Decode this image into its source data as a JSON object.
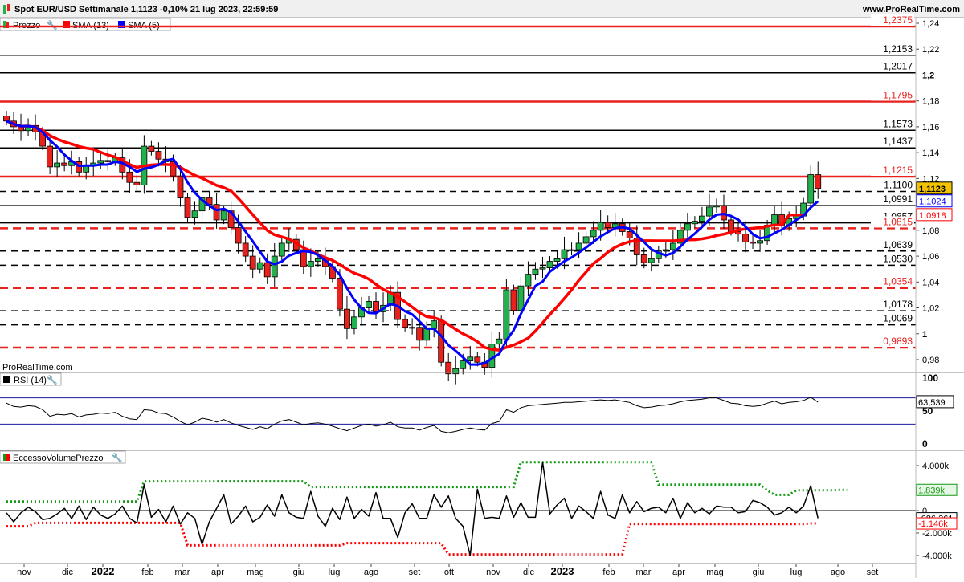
{
  "header": {
    "title": "Spot EUR/USD Settimanale 1,1123 -0,10% 21 lug 2023, 22:59:59",
    "site": "www.ProRealTime.com"
  },
  "watermark": "ProRealTime.com",
  "legend": {
    "price": "Prezzo",
    "sma13": "SMA (13)",
    "sma5": "SMA (5)"
  },
  "colors": {
    "up": "#22b14c",
    "down": "#e8211d",
    "sma13": "#ff0000",
    "sma5": "#0000ff",
    "support_red": "#e8211d",
    "volume_upper": "#139a13",
    "volume_lower": "#ff0000",
    "rsi_band": "#1a1aa0",
    "current_price_box": "#f2c300"
  },
  "chart_data": [
    {
      "type": "candlestick",
      "title": "Spot EUR/USD Settimanale",
      "ylim": [
        0.97,
        1.245
      ],
      "yticks": [
        {
          "v": 1.24,
          "label": "1,24"
        },
        {
          "v": 1.22,
          "label": "1,22"
        },
        {
          "v": 1.2,
          "label": "1,2"
        },
        {
          "v": 1.18,
          "label": "1,18"
        },
        {
          "v": 1.16,
          "label": "1,16"
        },
        {
          "v": 1.14,
          "label": "1,14"
        },
        {
          "v": 1.12,
          "label": "1,12"
        },
        {
          "v": 1.08,
          "label": "1,08"
        },
        {
          "v": 1.06,
          "label": "1,06"
        },
        {
          "v": 1.04,
          "label": "1,04"
        },
        {
          "v": 1.02,
          "label": "1,02"
        },
        {
          "v": 1.0,
          "label": "1"
        },
        {
          "v": 0.98,
          "label": "0,98"
        }
      ],
      "x_labels": [
        "nov",
        "dic",
        "2022",
        "feb",
        "mar",
        "apr",
        "mag",
        "giu",
        "lug",
        "ago",
        "set",
        "ott",
        "nov",
        "dic",
        "2023",
        "feb",
        "mar",
        "apr",
        "mag",
        "giu",
        "lug",
        "ago",
        "set"
      ],
      "bold_x_labels": [
        "2022",
        "2023"
      ],
      "levels": [
        {
          "value": 1.2375,
          "label": "1,2375",
          "color": "red",
          "style": "solid"
        },
        {
          "value": 1.2153,
          "label": "1,2153",
          "color": "black",
          "style": "solid"
        },
        {
          "value": 1.2017,
          "label": "1,2017",
          "color": "black",
          "style": "solid"
        },
        {
          "value": 1.1795,
          "label": "1,1795",
          "color": "red",
          "style": "solid"
        },
        {
          "value": 1.1573,
          "label": "1,1573",
          "color": "black",
          "style": "solid"
        },
        {
          "value": 1.1437,
          "label": "1,1437",
          "color": "black",
          "style": "solid"
        },
        {
          "value": 1.1215,
          "label": "1,1215",
          "color": "red",
          "style": "solid"
        },
        {
          "value": 1.11,
          "label": "1,1100",
          "color": "black",
          "style": "dashed"
        },
        {
          "value": 1.0991,
          "label": "1,0991",
          "color": "black",
          "style": "solid"
        },
        {
          "value": 1.0857,
          "label": "1,0857",
          "color": "black",
          "style": "solid"
        },
        {
          "value": 1.0815,
          "label": "1,0815",
          "color": "red",
          "style": "dashed"
        },
        {
          "value": 1.0639,
          "label": "1,0639",
          "color": "black",
          "style": "dashed"
        },
        {
          "value": 1.053,
          "label": "1,0530",
          "color": "black",
          "style": "dashed"
        },
        {
          "value": 1.0354,
          "label": "1,0354",
          "color": "red",
          "style": "dashed"
        },
        {
          "value": 1.0178,
          "label": "1,0178",
          "color": "black",
          "style": "dashed"
        },
        {
          "value": 1.0069,
          "label": "1,0069",
          "color": "black",
          "style": "dashed"
        },
        {
          "value": 0.9893,
          "label": "0,9893",
          "color": "red",
          "style": "dashed"
        }
      ],
      "price_tags": [
        {
          "value": 1.1123,
          "label": "1,1123",
          "kind": "last"
        },
        {
          "value": 1.1024,
          "label": "1,1024",
          "kind": "sma5"
        },
        {
          "value": 1.0918,
          "label": "1,0918",
          "kind": "sma13"
        }
      ],
      "closes": [
        1.1644,
        1.16,
        1.157,
        1.161,
        1.156,
        1.145,
        1.129,
        1.132,
        1.13,
        1.133,
        1.125,
        1.13,
        1.132,
        1.134,
        1.133,
        1.136,
        1.125,
        1.117,
        1.115,
        1.145,
        1.141,
        1.135,
        1.133,
        1.122,
        1.105,
        1.09,
        1.095,
        1.105,
        1.1,
        1.088,
        1.095,
        1.082,
        1.07,
        1.06,
        1.05,
        1.055,
        1.044,
        1.06,
        1.07,
        1.073,
        1.065,
        1.052,
        1.056,
        1.058,
        1.052,
        1.043,
        1.019,
        1.004,
        1.013,
        1.02,
        1.025,
        1.017,
        1.022,
        1.032,
        1.011,
        1.005,
        1.005,
        0.995,
        1.004,
        1.01,
        0.978,
        0.969,
        0.973,
        0.979,
        0.982,
        0.978,
        0.974,
        0.992,
        0.996,
        1.034,
        1.018,
        1.037,
        1.046,
        1.05,
        1.051,
        1.056,
        1.058,
        1.065,
        1.065,
        1.07,
        1.075,
        1.08,
        1.086,
        1.082,
        1.085,
        1.079,
        1.074,
        1.061,
        1.055,
        1.058,
        1.064,
        1.065,
        1.07,
        1.08,
        1.085,
        1.087,
        1.091,
        1.098,
        1.099,
        1.088,
        1.079,
        1.077,
        1.071,
        1.07,
        1.072,
        1.084,
        1.092,
        1.084,
        1.089,
        1.091,
        1.101,
        1.123,
        1.1123
      ]
    },
    {
      "type": "line",
      "title": "RSI (14)",
      "ylim": [
        0,
        100
      ],
      "yticks": [
        {
          "v": 100,
          "label": "100"
        },
        {
          "v": 50,
          "label": "50"
        },
        {
          "v": 0,
          "label": "0"
        }
      ],
      "bands": [
        70,
        30
      ],
      "last_label": "63,539",
      "values": [
        62,
        57,
        56,
        58,
        57,
        52,
        42,
        45,
        44,
        46,
        41,
        44,
        45,
        47,
        46,
        48,
        42,
        38,
        37,
        52,
        51,
        47,
        46,
        41,
        34,
        29,
        33,
        39,
        37,
        33,
        37,
        32,
        28,
        25,
        22,
        26,
        23,
        30,
        35,
        37,
        33,
        29,
        31,
        32,
        30,
        27,
        23,
        20,
        24,
        28,
        30,
        27,
        29,
        33,
        26,
        24,
        24,
        21,
        25,
        28,
        19,
        17,
        19,
        22,
        24,
        22,
        21,
        31,
        34,
        52,
        48,
        55,
        58,
        59,
        60,
        61,
        62,
        63,
        63,
        64,
        65,
        66,
        67,
        66,
        67,
        65,
        63,
        58,
        55,
        56,
        58,
        59,
        61,
        64,
        66,
        67,
        68,
        70,
        70,
        66,
        62,
        61,
        58,
        57,
        58,
        62,
        65,
        61,
        63,
        64,
        66,
        71,
        63.539
      ]
    },
    {
      "type": "line",
      "title": "EccessoVolumePrezzo",
      "ylim": [
        -4000,
        4000
      ],
      "yticks": [
        {
          "v": 4000,
          "label": "4.000k"
        },
        {
          "v": 2000,
          "label": "2.000k"
        },
        {
          "v": 0,
          "label": "0"
        },
        {
          "v": -2000,
          "label": "-2.000k"
        },
        {
          "v": -4000,
          "label": "-4.000k"
        }
      ],
      "value_tags": [
        {
          "value": 1839,
          "label": "1.839k",
          "kind": "upper"
        },
        {
          "value": -686.361,
          "label": "-686,361",
          "kind": "last"
        },
        {
          "value": -1146,
          "label": "-1.146k",
          "kind": "lower"
        }
      ],
      "series": [
        {
          "name": "EccessoVolumePrezzo",
          "values": [
            -200,
            -1000,
            -200,
            300,
            -100,
            -800,
            -700,
            -300,
            200,
            -700,
            400,
            -800,
            300,
            -400,
            -700,
            -300,
            400,
            -700,
            -1100,
            2300,
            -600,
            100,
            -1000,
            400,
            -1200,
            -200,
            -700,
            -3000,
            -1000,
            200,
            1400,
            -1200,
            -500,
            400,
            -1000,
            -600,
            500,
            -500,
            1400,
            -200,
            -600,
            -700,
            1700,
            -500,
            -1400,
            200,
            -800,
            1200,
            -700,
            100,
            -500,
            1600,
            -700,
            -700,
            -2400,
            -200,
            600,
            -700,
            -700,
            1400,
            300,
            1300,
            -700,
            -1400,
            -4000,
            1900,
            -700,
            -600,
            -700,
            1300,
            -600,
            700,
            -600,
            -600,
            4300,
            -300,
            500,
            1100,
            -700,
            400,
            -100,
            -700,
            1700,
            -400,
            -700,
            1400,
            -200,
            800,
            -100,
            200,
            300,
            -200,
            1100,
            -700,
            700,
            -200,
            200,
            -300,
            400,
            300,
            300,
            -200,
            -100,
            900,
            700,
            300,
            -400,
            -200,
            300,
            -200,
            400,
            2200,
            -686.361
          ]
        },
        {
          "name": "upper",
          "values": [
            800,
            800,
            800,
            800,
            800,
            800,
            800,
            800,
            800,
            800,
            800,
            800,
            800,
            800,
            800,
            800,
            800,
            800,
            800,
            2600,
            2600,
            2600,
            2600,
            2600,
            2600,
            2600,
            2600,
            2600,
            2600,
            2600,
            2600,
            2600,
            2600,
            2600,
            2600,
            2600,
            2600,
            2600,
            2600,
            2600,
            2600,
            2600,
            2100,
            2100,
            2100,
            2100,
            2100,
            2100,
            2100,
            2100,
            2100,
            2100,
            2100,
            2100,
            2100,
            2100,
            2100,
            2100,
            2100,
            2100,
            2100,
            2100,
            2100,
            2100,
            2100,
            2100,
            2100,
            2100,
            2100,
            2100,
            2100,
            4300,
            4300,
            4300,
            4300,
            4300,
            4300,
            4300,
            4300,
            4300,
            4300,
            4300,
            4300,
            4300,
            4300,
            4300,
            4300,
            4300,
            4300,
            4300,
            2300,
            2300,
            2300,
            2300,
            2300,
            2300,
            2300,
            2300,
            2300,
            2300,
            2300,
            2300,
            2300,
            2300,
            2300,
            1800,
            1400,
            1400,
            1400,
            1800,
            1800,
            1800,
            1800,
            1800,
            1800,
            1839,
            1839
          ]
        },
        {
          "name": "lower",
          "values": [
            -1400,
            -1400,
            -1400,
            -1400,
            -1100,
            -1100,
            -1100,
            -1100,
            -1100,
            -1100,
            -1100,
            -1100,
            -1100,
            -1100,
            -1100,
            -1100,
            -1100,
            -1100,
            -1100,
            -1100,
            -1100,
            -1100,
            -1100,
            -1100,
            -1100,
            -3100,
            -3100,
            -3100,
            -3100,
            -3100,
            -3100,
            -3100,
            -3100,
            -3100,
            -3100,
            -3100,
            -3100,
            -3100,
            -3100,
            -3100,
            -3100,
            -3100,
            -3100,
            -3100,
            -3100,
            -3100,
            -3100,
            -2900,
            -2900,
            -2900,
            -2900,
            -2900,
            -2900,
            -2900,
            -2900,
            -2900,
            -2900,
            -2900,
            -2900,
            -2900,
            -2900,
            -3900,
            -3900,
            -3900,
            -3900,
            -3900,
            -3900,
            -3900,
            -3900,
            -3900,
            -3900,
            -3900,
            -3900,
            -3900,
            -3900,
            -3900,
            -3900,
            -3900,
            -3900,
            -3900,
            -3900,
            -3900,
            -3900,
            -3900,
            -3900,
            -3900,
            -1200,
            -1200,
            -1200,
            -1200,
            -1200,
            -1200,
            -1200,
            -1200,
            -1200,
            -1200,
            -1200,
            -1200,
            -1200,
            -1200,
            -1200,
            -1200,
            -1200,
            -1200,
            -1200,
            -1200,
            -1200,
            -1200,
            -1200,
            -1200,
            -1200,
            -1146,
            -1146
          ]
        }
      ]
    }
  ]
}
